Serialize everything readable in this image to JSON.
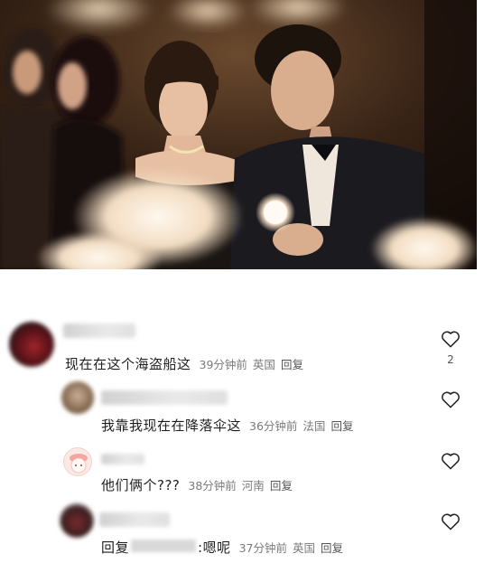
{
  "photo": {
    "description_icon": "photo"
  },
  "comments": [
    {
      "text": "现在在这个海盗船这",
      "time": "39分钟前",
      "location": "英国",
      "reply_label": "回复",
      "likes": "2"
    },
    {
      "text": "我靠我现在在降落伞这",
      "time": "36分钟前",
      "location": "法国",
      "reply_label": "回复"
    },
    {
      "text": "他们俩个???",
      "time": "38分钟前",
      "location": "河南",
      "reply_label": "回复"
    },
    {
      "reply_prefix": "回复",
      "text": ":嗯呢",
      "time": "37分钟前",
      "location": "英国",
      "reply_label": "回复"
    }
  ],
  "icons": {
    "like": "heart-outline-icon"
  },
  "colors": {
    "meta_text": "#7a7a7a",
    "body_text": "#1e1e1e"
  }
}
